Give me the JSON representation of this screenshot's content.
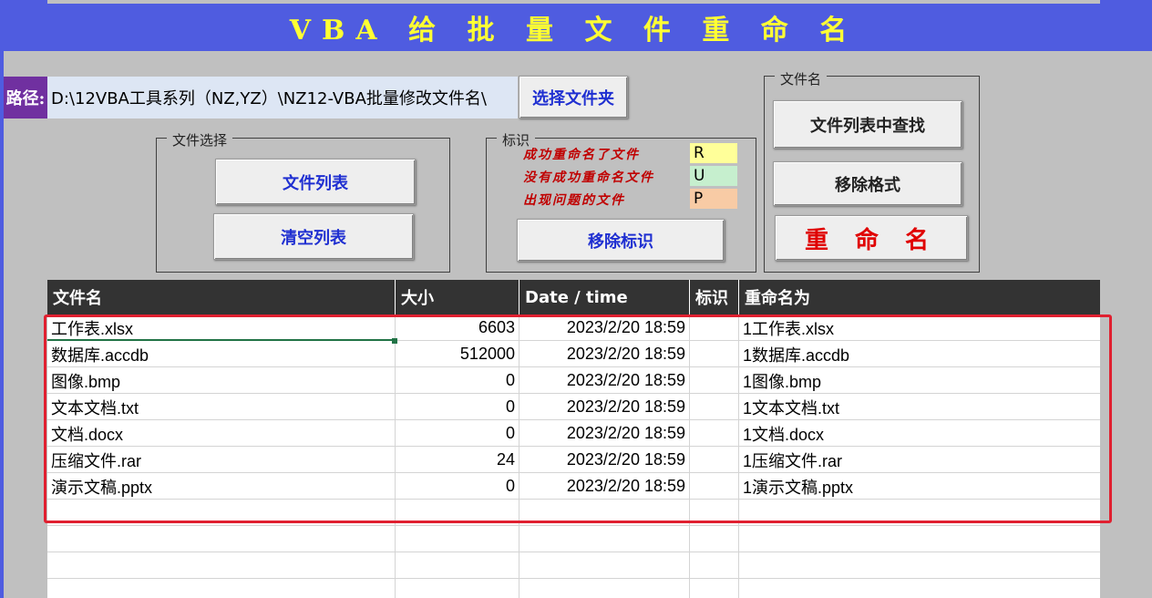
{
  "title": "VBA 给 批 量 文 件 重 命 名",
  "path": {
    "label": "路径:",
    "value": "D:\\12VBA工具系列（NZ,YZ）\\NZ12-VBA批量修改文件名\\"
  },
  "buttons": {
    "select_folder": "选择文件夹",
    "file_list": "文件列表",
    "clear_list": "清空列表",
    "remove_mark": "移除标识",
    "find_in_list": "文件列表中查找",
    "remove_format": "移除格式",
    "rename": "重 命 名"
  },
  "groups": {
    "file_select": "文件选择",
    "mark": "标识",
    "file_name": "文件名"
  },
  "legend": [
    {
      "text": "成功重命名了文件",
      "code": "R",
      "color": "#ffff99"
    },
    {
      "text": "没有成功重命名文件",
      "code": "U",
      "color": "#c6efce"
    },
    {
      "text": "出现问题的文件",
      "code": "P",
      "color": "#f8cba5"
    }
  ],
  "table": {
    "headers": [
      "文件名",
      "大小",
      "Date / time",
      "标识",
      "重命名为"
    ],
    "rows": [
      [
        "工作表.xlsx",
        "6603",
        "2023/2/20 18:59",
        "",
        "1工作表.xlsx"
      ],
      [
        "数据库.accdb",
        "512000",
        "2023/2/20 18:59",
        "",
        "1数据库.accdb"
      ],
      [
        "图像.bmp",
        "0",
        "2023/2/20 18:59",
        "",
        "1图像.bmp"
      ],
      [
        "文本文档.txt",
        "0",
        "2023/2/20 18:59",
        "",
        "1文本文档.txt"
      ],
      [
        "文档.docx",
        "0",
        "2023/2/20 18:59",
        "",
        "1文档.docx"
      ],
      [
        "压缩文件.rar",
        "24",
        "2023/2/20 18:59",
        "",
        "1压缩文件.rar"
      ],
      [
        "演示文稿.pptx",
        "0",
        "2023/2/20 18:59",
        "",
        "1演示文稿.pptx"
      ]
    ]
  }
}
